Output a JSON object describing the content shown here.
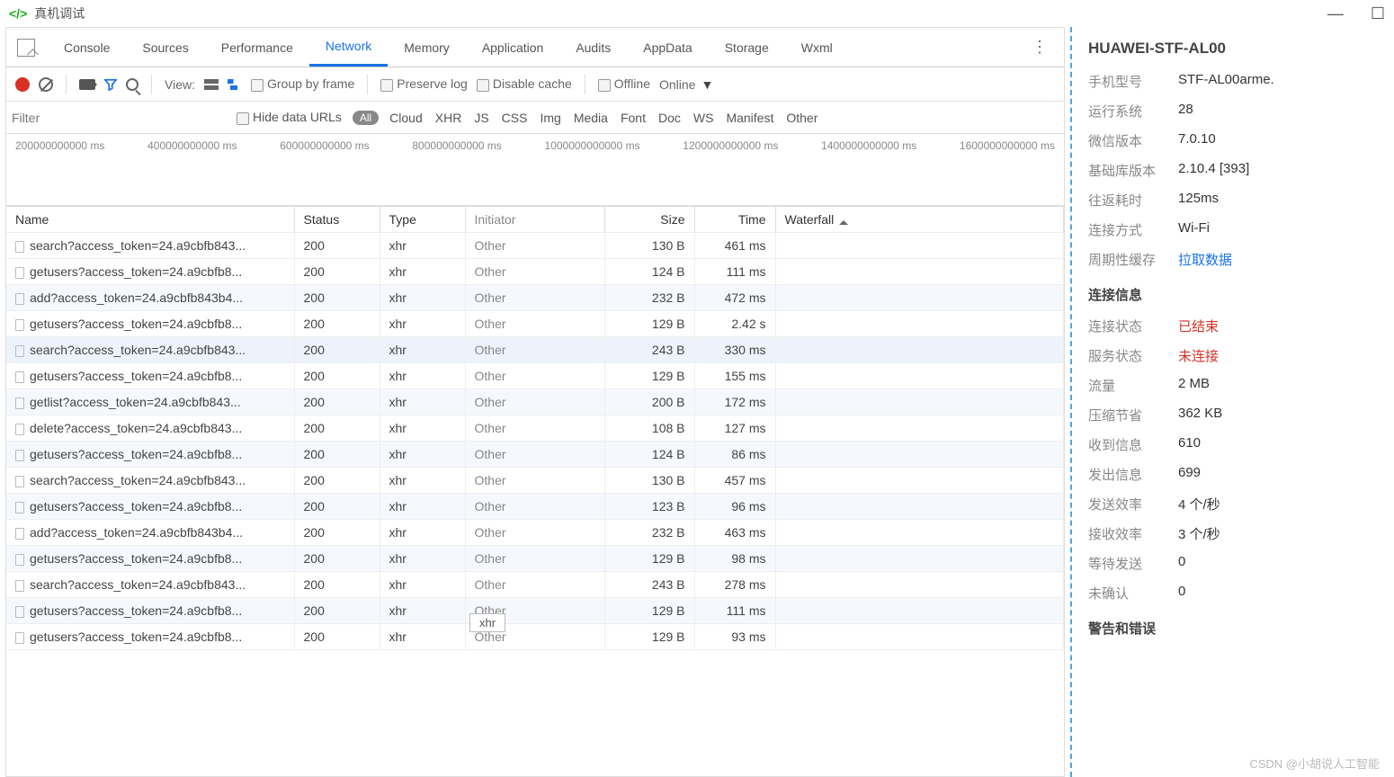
{
  "window": {
    "title": "真机调试"
  },
  "tabs": [
    "Console",
    "Sources",
    "Performance",
    "Network",
    "Memory",
    "Application",
    "Audits",
    "AppData",
    "Storage",
    "Wxml"
  ],
  "activeTab": "Network",
  "toolbar2": {
    "view_label": "View:",
    "group_by_frame": "Group by frame",
    "preserve_log": "Preserve log",
    "disable_cache": "Disable cache",
    "offline": "Offline",
    "online": "Online"
  },
  "toolbar3": {
    "filter_placeholder": "Filter",
    "hide_data_urls": "Hide data URLs",
    "all_pill": "All",
    "types": [
      "Cloud",
      "XHR",
      "JS",
      "CSS",
      "Img",
      "Media",
      "Font",
      "Doc",
      "WS",
      "Manifest",
      "Other"
    ]
  },
  "timeline": [
    "200000000000 ms",
    "400000000000 ms",
    "600000000000 ms",
    "800000000000 ms",
    "1000000000000 ms",
    "1200000000000 ms",
    "1400000000000 ms",
    "1600000000000 ms"
  ],
  "columns": {
    "name": "Name",
    "status": "Status",
    "type": "Type",
    "initiator": "Initiator",
    "size": "Size",
    "time": "Time",
    "waterfall": "Waterfall"
  },
  "tooltip": "xhr",
  "requests": [
    {
      "name": "search?access_token=24.a9cbfb843...",
      "status": "200",
      "type": "xhr",
      "initiator": "Other",
      "size": "130 B",
      "time": "461 ms"
    },
    {
      "name": "getusers?access_token=24.a9cbfb8...",
      "status": "200",
      "type": "xhr",
      "initiator": "Other",
      "size": "124 B",
      "time": "111 ms"
    },
    {
      "name": "add?access_token=24.a9cbfb843b4...",
      "status": "200",
      "type": "xhr",
      "initiator": "Other",
      "size": "232 B",
      "time": "472 ms"
    },
    {
      "name": "getusers?access_token=24.a9cbfb8...",
      "status": "200",
      "type": "xhr",
      "initiator": "Other",
      "size": "129 B",
      "time": "2.42 s"
    },
    {
      "name": "search?access_token=24.a9cbfb843...",
      "status": "200",
      "type": "xhr",
      "initiator": "Other",
      "size": "243 B",
      "time": "330 ms",
      "hover": true
    },
    {
      "name": "getusers?access_token=24.a9cbfb8...",
      "status": "200",
      "type": "xhr",
      "initiator": "Other",
      "size": "129 B",
      "time": "155 ms"
    },
    {
      "name": "getlist?access_token=24.a9cbfb843...",
      "status": "200",
      "type": "xhr",
      "initiator": "Other",
      "size": "200 B",
      "time": "172 ms"
    },
    {
      "name": "delete?access_token=24.a9cbfb843...",
      "status": "200",
      "type": "xhr",
      "initiator": "Other",
      "size": "108 B",
      "time": "127 ms"
    },
    {
      "name": "getusers?access_token=24.a9cbfb8...",
      "status": "200",
      "type": "xhr",
      "initiator": "Other",
      "size": "124 B",
      "time": "86 ms"
    },
    {
      "name": "search?access_token=24.a9cbfb843...",
      "status": "200",
      "type": "xhr",
      "initiator": "Other",
      "size": "130 B",
      "time": "457 ms"
    },
    {
      "name": "getusers?access_token=24.a9cbfb8...",
      "status": "200",
      "type": "xhr",
      "initiator": "Other",
      "size": "123 B",
      "time": "96 ms"
    },
    {
      "name": "add?access_token=24.a9cbfb843b4...",
      "status": "200",
      "type": "xhr",
      "initiator": "Other",
      "size": "232 B",
      "time": "463 ms"
    },
    {
      "name": "getusers?access_token=24.a9cbfb8...",
      "status": "200",
      "type": "xhr",
      "initiator": "Other",
      "size": "129 B",
      "time": "98 ms"
    },
    {
      "name": "search?access_token=24.a9cbfb843...",
      "status": "200",
      "type": "xhr",
      "initiator": "Other",
      "size": "243 B",
      "time": "278 ms"
    },
    {
      "name": "getusers?access_token=24.a9cbfb8...",
      "status": "200",
      "type": "xhr",
      "initiator": "Other",
      "size": "129 B",
      "time": "111 ms"
    },
    {
      "name": "getusers?access_token=24.a9cbfb8...",
      "status": "200",
      "type": "xhr",
      "initiator": "Other",
      "size": "129 B",
      "time": "93 ms"
    }
  ],
  "rpanel": {
    "device": "HUAWEI-STF-AL00",
    "info": [
      {
        "k": "手机型号",
        "v": "STF-AL00arme."
      },
      {
        "k": "运行系统",
        "v": "28"
      },
      {
        "k": "微信版本",
        "v": "7.0.10"
      },
      {
        "k": "基础库版本",
        "v": "2.10.4 [393]"
      },
      {
        "k": "往返耗时",
        "v": "125ms"
      },
      {
        "k": "连接方式",
        "v": "Wi-Fi"
      },
      {
        "k": "周期性缓存",
        "v": "拉取数据",
        "link": true
      }
    ],
    "conn_header": "连接信息",
    "conn": [
      {
        "k": "连接状态",
        "v": "已结束",
        "red": true
      },
      {
        "k": "服务状态",
        "v": "未连接",
        "red": true
      },
      {
        "k": "流量",
        "v": "2 MB"
      },
      {
        "k": "压缩节省",
        "v": "362 KB"
      },
      {
        "k": "收到信息",
        "v": "610"
      },
      {
        "k": "发出信息",
        "v": "699"
      },
      {
        "k": "发送效率",
        "v": "4 个/秒"
      },
      {
        "k": "接收效率",
        "v": "3 个/秒"
      },
      {
        "k": "等待发送",
        "v": "0"
      },
      {
        "k": "未确认",
        "v": "0"
      }
    ],
    "warn_header": "警告和错误"
  },
  "watermark": "CSDN @小胡说人工智能"
}
